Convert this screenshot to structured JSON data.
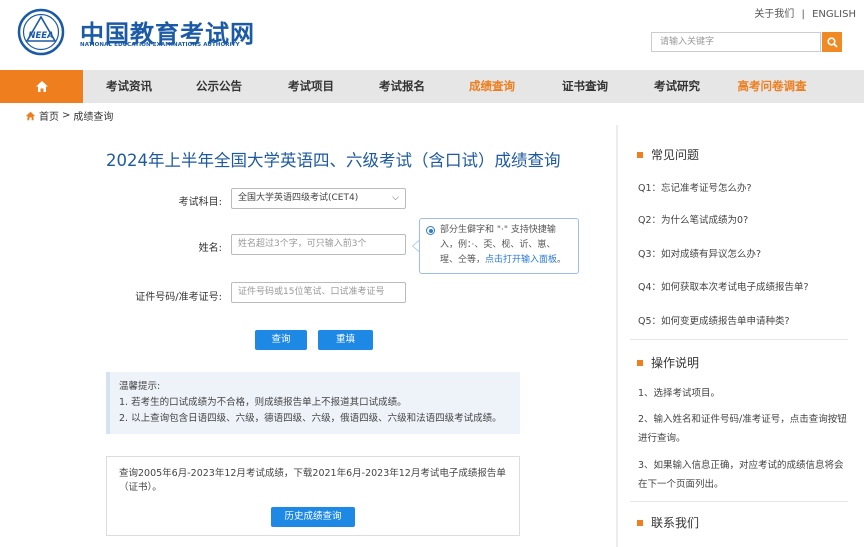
{
  "header": {
    "site_name_cn": "中国教育考试网",
    "site_name_en": "NATIONAL EDUCATION EXAMINATIONS AUTHORITY",
    "logo_text": "NEEA",
    "about_link": "关于我们",
    "separator": "|",
    "english_link": "ENGLISH",
    "search_placeholder": "请输入关键字",
    "search_icon": "search-icon"
  },
  "nav": {
    "home_icon": "home-icon",
    "items": [
      "考试资讯",
      "公示公告",
      "考试项目",
      "考试报名",
      "成绩查询",
      "证书查询",
      "考试研究",
      "高考问卷调查"
    ]
  },
  "breadcrumb": {
    "home": "首页",
    "sep": ">",
    "current": "成绩查询"
  },
  "main": {
    "title": "2024年上半年全国大学英语四、六级考试（含口试）成绩查询",
    "subject_label": "考试科目:",
    "subject_value": "全国大学英语四级考试(CET4)",
    "name_label": "姓名:",
    "name_placeholder": "姓名超过3个字，可只输入前3个",
    "id_label": "证件号码/准考证号:",
    "id_placeholder": "证件号码或15位笔试、口试准考证号",
    "tip_line1": "部分生僻字和 \"·\" 支持快捷输",
    "tip_line2": "入，例：·、奀、枧、䜣、崽、",
    "tip_line3_text": "瑆、仝等，",
    "tip_line3_link": "点击打开输入面板",
    "tip_line3_end": "。",
    "query_button": "查询",
    "reset_button": "重填",
    "notice_title": "温馨提示:",
    "notice_1": "1. 若考生的口试成绩为不合格，则成绩报告单上不报道其口试成绩。",
    "notice_2": "2. 以上查询包含日语四级、六级，德语四级、六级，俄语四级、六级和法语四级考试成绩。",
    "history_text": "查询2005年6月-2023年12月考试成绩，下载2021年6月-2023年12月考试电子成绩报告单（证书）。",
    "history_button": "历史成绩查询"
  },
  "sidebar": {
    "faq_title": "常见问题",
    "faq": [
      "Q1：忘记准考证号怎么办?",
      "Q2：为什么笔试成绩为0?",
      "Q3：如对成绩有异议怎么办?",
      "Q4：如何获取本次考试电子成绩报告单?",
      "Q5：如何变更成绩报告单申请种类?"
    ],
    "guide_title": "操作说明",
    "guide_1": "1、选择考试项目。",
    "guide_2": "2、输入姓名和证件号码/准考证号，点击查询按钮进行查询。",
    "guide_3": "3、如果输入信息正确，对应考试的成绩信息将会在下一个页面列出。",
    "contact_title": "联系我们"
  },
  "colors": {
    "brand_blue": "#1b5aa6",
    "accent_orange": "#ee7e1e",
    "button_blue": "#1e88e5",
    "title_blue": "#1e5aa0"
  }
}
